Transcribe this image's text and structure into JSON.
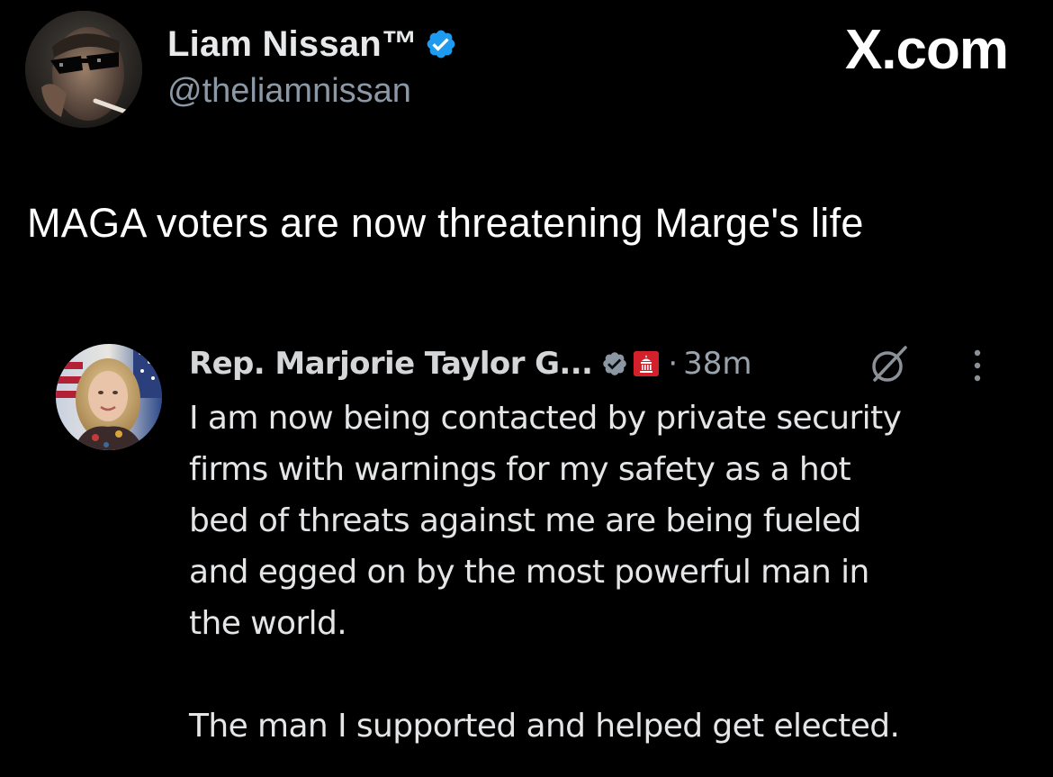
{
  "post": {
    "author_name": "Liam Nissan™",
    "author_handle": "@theliamnissan",
    "brand": "X.com",
    "text": "MAGA voters are now threatening Marge's life"
  },
  "quoted_post": {
    "author_name": "Rep. Marjorie Taylor G...",
    "separator": "·",
    "timestamp": "38m",
    "body_lines": [
      "I am now being contacted by private security",
      "firms with warnings for my safety as a hot",
      "bed of threats against me are being fueled",
      "and egged on by the most powerful man in",
      "the world."
    ],
    "body_final": "The man I supported and helped get elected."
  },
  "icons": {
    "verified": "verified-badge-icon",
    "affiliation": "capitol-affiliation-icon",
    "grok": "grok-icon",
    "more": "more-vertical-icon"
  },
  "colors": {
    "background": "#000000",
    "verified_blue": "#1d9bf0",
    "verified_gray": "#8a97a3",
    "affiliation_red": "#d3212c",
    "secondary_text": "#8b98a5"
  }
}
